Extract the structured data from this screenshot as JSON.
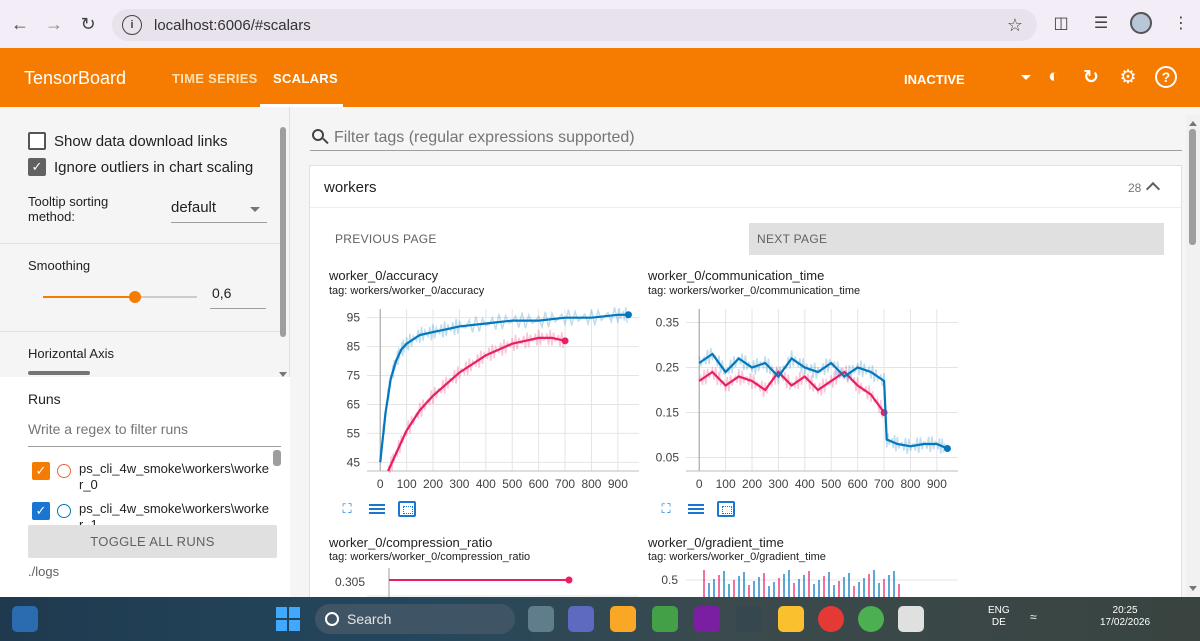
{
  "browser": {
    "url": "localhost:6006/#scalars",
    "back_icon": "back-arrow-icon",
    "forward_icon": "forward-arrow-icon",
    "reload_icon": "reload-icon"
  },
  "header": {
    "logo": "TensorBoard",
    "tabs": [
      {
        "label": "TIME SERIES",
        "active": false
      },
      {
        "label": "SCALARS",
        "active": true
      }
    ],
    "status": "INACTIVE",
    "accent_color": "#f57c00"
  },
  "sidebar": {
    "show_download_links": {
      "label": "Show data download links",
      "checked": false
    },
    "ignore_outliers": {
      "label": "Ignore outliers in chart scaling",
      "checked": true
    },
    "tooltip_sorting": {
      "label_line1": "Tooltip sorting",
      "label_line2": "method:",
      "value": "default"
    },
    "smoothing": {
      "label": "Smoothing",
      "value": "0,6",
      "fraction": 0.6
    },
    "horizontal_axis_label": "Horizontal Axis",
    "runs": {
      "title": "Runs",
      "filter_placeholder": "Write a regex to filter runs",
      "items": [
        {
          "name": "ps_cli_4w_smoke\\workers\\worker_0",
          "color": "#f57c00",
          "circle_color": "#e8673c",
          "checked": true
        },
        {
          "name": "ps_cli_4w_smoke\\workers\\worker_1",
          "color": "#1976d2",
          "circle_color": "#0277bd",
          "checked": true
        }
      ],
      "toggle_all": "TOGGLE ALL RUNS",
      "logdir": "./logs"
    }
  },
  "main": {
    "filter_placeholder": "Filter tags (regular expressions supported)",
    "group": {
      "name": "workers",
      "count": "28"
    },
    "prev_page": "PREVIOUS PAGE",
    "next_page": "NEXT PAGE",
    "charts": [
      {
        "title": "worker_0/accuracy",
        "tag": "tag: workers/worker_0/accuracy"
      },
      {
        "title": "worker_0/communication_time",
        "tag": "tag: workers/worker_0/communication_time"
      },
      {
        "title": "worker_0/compression_ratio",
        "tag": "tag: workers/worker_0/compression_ratio"
      },
      {
        "title": "worker_0/gradient_time",
        "tag": "tag: workers/worker_0/gradient_time"
      }
    ]
  },
  "chart_data": [
    {
      "type": "line",
      "title": "worker_0/accuracy",
      "x_ticks": [
        "0",
        "100",
        "200",
        "300",
        "400",
        "500",
        "600",
        "700",
        "800",
        "900"
      ],
      "y_ticks": [
        "45",
        "55",
        "65",
        "75",
        "85",
        "95"
      ],
      "xlim": [
        -50,
        980
      ],
      "ylim": [
        42,
        98
      ],
      "series": [
        {
          "color": "#e91e63",
          "x": [
            30,
            60,
            100,
            150,
            200,
            250,
            300,
            350,
            400,
            450,
            500,
            550,
            600,
            650,
            700
          ],
          "y": [
            42,
            48,
            56,
            63,
            68,
            72,
            76,
            79,
            82,
            84,
            86,
            87,
            88,
            88,
            87
          ]
        },
        {
          "color": "#0277bd",
          "x": [
            0,
            20,
            40,
            60,
            80,
            100,
            150,
            200,
            250,
            300,
            400,
            500,
            600,
            700,
            800,
            900,
            940
          ],
          "y": [
            45,
            62,
            74,
            80,
            84,
            86,
            89,
            90,
            91,
            92,
            93,
            94,
            94,
            95,
            95,
            96,
            96
          ]
        }
      ]
    },
    {
      "type": "line",
      "title": "worker_0/communication_time",
      "x_ticks": [
        "0",
        "100",
        "200",
        "300",
        "400",
        "500",
        "600",
        "700",
        "800",
        "900"
      ],
      "y_ticks": [
        "0.35",
        "0.25",
        "0.15",
        "0.05"
      ],
      "xlim": [
        -50,
        980
      ],
      "ylim": [
        0.02,
        0.38
      ],
      "series": [
        {
          "color": "#e91e63",
          "x": [
            0,
            50,
            100,
            150,
            200,
            250,
            300,
            350,
            400,
            450,
            500,
            550,
            600,
            650,
            700
          ],
          "y": [
            0.22,
            0.24,
            0.21,
            0.23,
            0.22,
            0.2,
            0.24,
            0.21,
            0.23,
            0.2,
            0.22,
            0.24,
            0.21,
            0.19,
            0.15
          ]
        },
        {
          "color": "#0277bd",
          "x": [
            0,
            50,
            100,
            150,
            200,
            250,
            300,
            350,
            400,
            450,
            500,
            550,
            600,
            650,
            700,
            710,
            750,
            800,
            850,
            900,
            940
          ],
          "y": [
            0.26,
            0.28,
            0.24,
            0.27,
            0.25,
            0.26,
            0.23,
            0.27,
            0.25,
            0.24,
            0.26,
            0.23,
            0.25,
            0.24,
            0.22,
            0.09,
            0.08,
            0.075,
            0.08,
            0.08,
            0.07
          ]
        }
      ]
    },
    {
      "type": "line",
      "title": "worker_0/compression_ratio",
      "y_ticks": [
        "0.305"
      ],
      "series": [
        {
          "color": "#e91e63",
          "x": [
            0,
            700
          ],
          "y": [
            0.305,
            0.305
          ]
        }
      ]
    },
    {
      "type": "line",
      "title": "worker_0/gradient_time",
      "y_ticks": [
        "0.5"
      ],
      "series": []
    }
  ]
}
